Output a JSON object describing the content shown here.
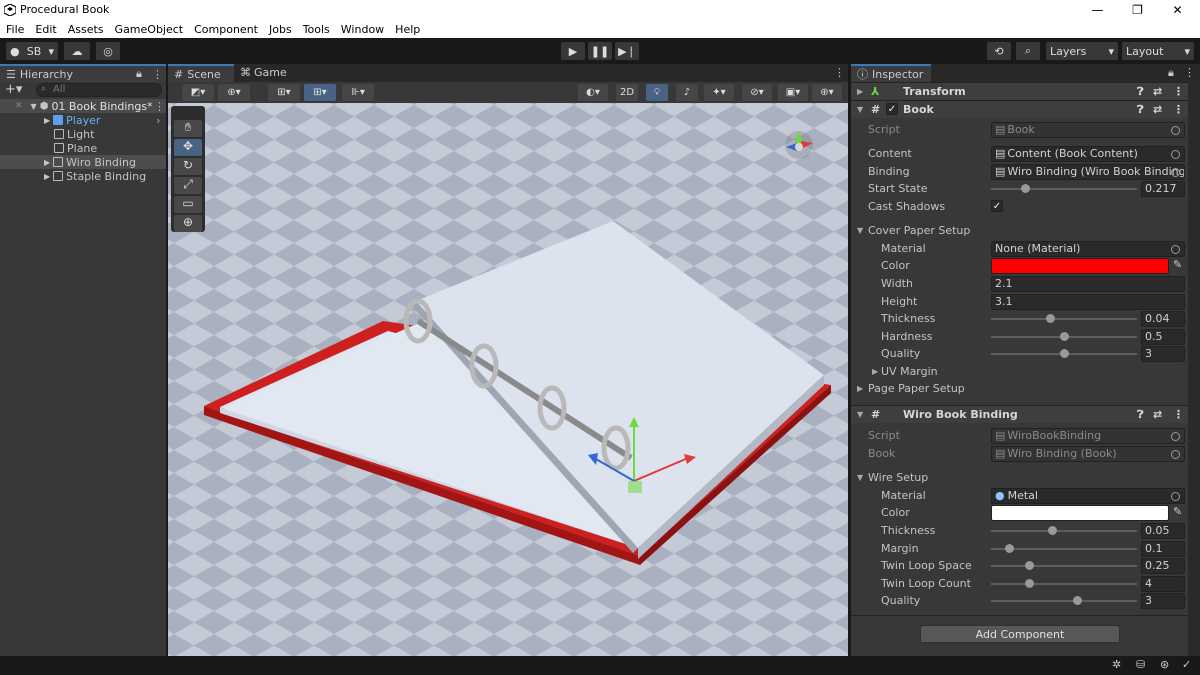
{
  "window": {
    "title": "Procedural Book"
  },
  "menu": [
    "File",
    "Edit",
    "Assets",
    "GameObject",
    "Component",
    "Jobs",
    "Tools",
    "Window",
    "Help"
  ],
  "toolbar": {
    "account": "SB",
    "layers": "Layers",
    "layout": "Layout"
  },
  "hierarchy": {
    "tab": "Hierarchy",
    "search_placeholder": "All",
    "scene": "01 Book Bindings*",
    "items": [
      "Player",
      "Light",
      "Plane",
      "Wiro Binding",
      "Staple Binding"
    ]
  },
  "scene_tabs": {
    "scene": "Scene",
    "game": "Game",
    "mode_2d": "2D"
  },
  "inspector": {
    "tab": "Inspector",
    "transform": "Transform",
    "book": {
      "title": "Book",
      "script_label": "Script",
      "script_value": "Book",
      "content_label": "Content",
      "content_value": "Content (Book Content)",
      "binding_label": "Binding",
      "binding_value": "Wiro Binding (Wiro Book Binding)",
      "start_state_label": "Start State",
      "start_state_value": "0.217",
      "start_state": 0.217,
      "cast_shadows_label": "Cast Shadows",
      "cover_section": "Cover Paper Setup",
      "material_label": "Material",
      "material_value": "None (Material)",
      "color_label": "Color",
      "color": "#ff0000",
      "width_label": "Width",
      "width_value": "2.1",
      "height_label": "Height",
      "height_value": "3.1",
      "thickness_label": "Thickness",
      "thickness_value": "0.04",
      "hardness_label": "Hardness",
      "hardness_value": "0.5",
      "quality_label": "Quality",
      "quality_value": "3",
      "uv_margin": "UV Margin",
      "page_section": "Page Paper Setup"
    },
    "wiro": {
      "title": "Wiro Book Binding",
      "script_label": "Script",
      "script_value": "WiroBookBinding",
      "book_label": "Book",
      "book_value": "Wiro Binding (Book)",
      "wire_section": "Wire Setup",
      "material_label": "Material",
      "material_value": "Metal",
      "color_label": "Color",
      "color": "#ffffff",
      "thickness_label": "Thickness",
      "thickness_value": "0.05",
      "margin_label": "Margin",
      "margin_value": "0.1",
      "twin_space_label": "Twin Loop Space",
      "twin_space_value": "0.25",
      "twin_count_label": "Twin Loop Count",
      "twin_count_value": "4",
      "quality_label": "Quality",
      "quality_value": "3"
    },
    "add_component": "Add Component"
  }
}
